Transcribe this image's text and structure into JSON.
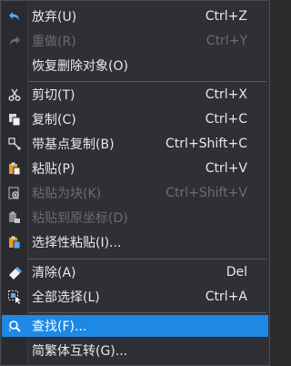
{
  "menu": {
    "items": [
      {
        "label": "放弃(U)",
        "shortcut": "Ctrl+Z",
        "icon": "undo-icon",
        "enabled": true
      },
      {
        "label": "重做(R)",
        "shortcut": "Ctrl+Y",
        "icon": "redo-icon",
        "enabled": false
      },
      {
        "label": "恢复删除对象(O)",
        "shortcut": "",
        "icon": "",
        "enabled": true
      },
      {
        "label": "剪切(T)",
        "shortcut": "Ctrl+X",
        "icon": "scissors-icon",
        "enabled": true
      },
      {
        "label": "复制(C)",
        "shortcut": "Ctrl+C",
        "icon": "copy-icon",
        "enabled": true
      },
      {
        "label": "带基点复制(B)",
        "shortcut": "Ctrl+Shift+C",
        "icon": "copy-with-basepoint-icon",
        "enabled": true
      },
      {
        "label": "粘贴(P)",
        "shortcut": "Ctrl+V",
        "icon": "paste-icon",
        "enabled": true
      },
      {
        "label": "粘贴为块(K)",
        "shortcut": "Ctrl+Shift+V",
        "icon": "paste-as-block-icon",
        "enabled": false
      },
      {
        "label": "粘贴到原坐标(D)",
        "shortcut": "",
        "icon": "paste-to-original-coords-icon",
        "enabled": false
      },
      {
        "label": "选择性粘贴(I)...",
        "shortcut": "",
        "icon": "paste-special-icon",
        "enabled": true
      },
      {
        "label": "清除(A)",
        "shortcut": "Del",
        "icon": "eraser-icon",
        "enabled": true
      },
      {
        "label": "全部选择(L)",
        "shortcut": "Ctrl+A",
        "icon": "select-all-icon",
        "enabled": true
      },
      {
        "label": "查找(F)...",
        "shortcut": "",
        "icon": "find-icon",
        "enabled": true,
        "selected": true
      },
      {
        "label": "简繁体互转(G)...",
        "shortcut": "",
        "icon": "",
        "enabled": true
      }
    ]
  },
  "colors": {
    "menu_bg": "#2f3035",
    "highlight": "#1e88e5",
    "text": "#e8e8e8",
    "disabled_text": "#6a6c72"
  }
}
